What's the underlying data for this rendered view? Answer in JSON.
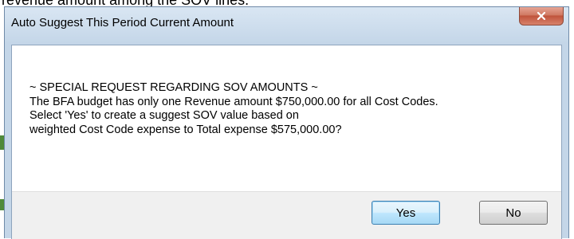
{
  "background": {
    "caption": "revenue amount among the SOV lines."
  },
  "dialog": {
    "title": "Auto Suggest This Period Current Amount",
    "close_icon": "close-x-icon",
    "message_lines": [
      "~ SPECIAL REQUEST REGARDING SOV AMOUNTS ~",
      "The BFA budget has only one Revenue amount $750,000.00 for all Cost Codes.",
      "Select 'Yes' to create a suggest SOV value based on",
      "weighted Cost Code expense to Total expense $575,000.00?"
    ],
    "buttons": {
      "yes": "Yes",
      "no": "No"
    }
  },
  "colors": {
    "title_bar": "#c4d6e8",
    "close_button": "#c0533c",
    "button_area": "#f0f0f0",
    "default_button_border": "#3c7fb1"
  }
}
